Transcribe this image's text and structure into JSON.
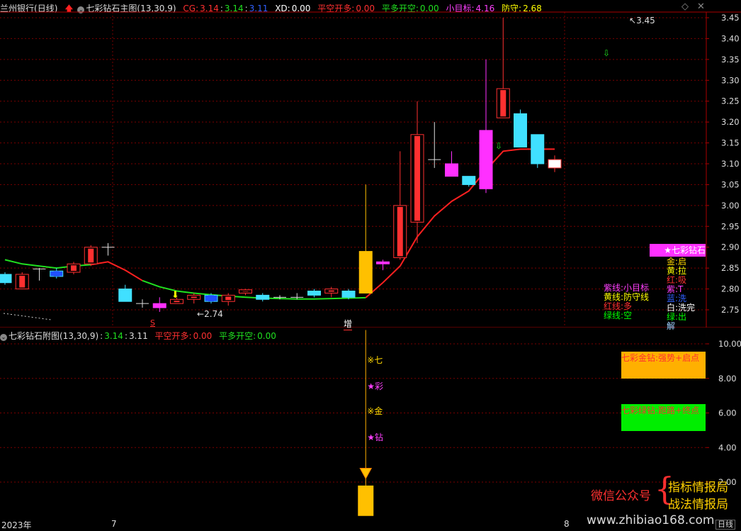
{
  "header": {
    "stock_name": "兰州银行",
    "period": "(日线)",
    "indicator_main": "七彩钻石主图(13,30,9)",
    "cg_label": "CG:",
    "cg_values": [
      "3.14",
      "3.14",
      "3.11"
    ],
    "xd_label": "XD:",
    "xd_value": "0.00",
    "pingkong_label": "平空开多:",
    "pingkong_value": "0.00",
    "pingduo_label": "平多开空:",
    "pingduo_value": "0.00",
    "target_label": "小目标:",
    "target_value": "4.16",
    "defense_label": "防守:",
    "defense_value": "2.68"
  },
  "sub_header": {
    "indicator": "七彩钻石附图(13,30,9)",
    "v1": "3.14",
    "v2": "3.11",
    "pingkong_label": "平空开多:",
    "pingkong_value": "0.00",
    "pingduo_label": "平多开空:",
    "pingduo_value": "0.00"
  },
  "main_axis": {
    "min": 2.7,
    "max": 3.475,
    "ticks": [
      "3.45",
      "3.40",
      "3.35",
      "3.30",
      "3.25",
      "3.20",
      "3.15",
      "3.10",
      "3.05",
      "3.00",
      "2.95",
      "2.90",
      "2.85",
      "2.80",
      "2.75"
    ]
  },
  "sub_axis": {
    "min": 0,
    "max": 11,
    "ticks": [
      "10.00",
      "8.00",
      "6.00",
      "4.00",
      "2.00"
    ]
  },
  "x_axis": {
    "labels": [
      "2023年",
      "7",
      "8"
    ],
    "period_button": "日线"
  },
  "annotations": {
    "high_price": "3.45",
    "low_price": "2.74",
    "s_marker": "S",
    "zeng_marker": "增"
  },
  "main_legend": {
    "title": "★七彩钻石",
    "right_items": [
      {
        "text": "金:启",
        "color": "#ffd700"
      },
      {
        "text": "黄:拉",
        "color": "#ffff00"
      },
      {
        "text": "红:吸",
        "color": "#ff3030"
      },
      {
        "text": "紫:T",
        "color": "#ff40ff"
      },
      {
        "text": "蓝:洗",
        "color": "#3060ff"
      },
      {
        "text": "白:洗完",
        "color": "#ffffff"
      },
      {
        "text": "绿:出",
        "color": "#00ff00"
      },
      {
        "text": "解",
        "color": "#a0d0ff"
      }
    ],
    "left_items": [
      {
        "text": "紫线:小目标",
        "color": "#ff40ff"
      },
      {
        "text": "黄线:防守线",
        "color": "#ffff00"
      },
      {
        "text": "红线:多",
        "color": "#ff3030"
      },
      {
        "text": "绿线:空",
        "color": "#00ff00"
      }
    ]
  },
  "sub_legend": [
    {
      "text": "七彩金钻:强势+启点",
      "bg": "#ffb000",
      "color": "#ff3030"
    },
    {
      "text": "七彩绿钻:跑路+终点",
      "bg": "#00ee00",
      "color": "#ff3030"
    }
  ],
  "sub_signals": [
    {
      "text": "※七",
      "color": "#ffd700"
    },
    {
      "text": "★彩",
      "color": "#ff40ff"
    },
    {
      "text": "※金",
      "color": "#ffd700"
    },
    {
      "text": "★钻",
      "color": "#ff40ff"
    }
  ],
  "watermark": {
    "prefix": "微信公众号",
    "line1": "指标情报局",
    "line2": "战法情报局",
    "url": "www.zhibiao168.com"
  },
  "colors": {
    "up": "#ff3030",
    "down_cyan": "#40e0ff",
    "down_blue": "#2050ff",
    "magenta": "#ff30ff",
    "gold": "#ffc000",
    "line_red": "#ff2020",
    "line_green": "#20e020",
    "grid": "#7a0000"
  },
  "chart_data": {
    "type": "candlestick",
    "candles": [
      {
        "o": 2.835,
        "c": 2.815,
        "h": 2.84,
        "l": 2.81,
        "t": "cyan"
      },
      {
        "o": 2.8,
        "c": 2.835,
        "h": 2.84,
        "l": 2.8,
        "t": "up"
      },
      {
        "o": 2.848,
        "c": 2.848,
        "h": 2.85,
        "l": 2.82,
        "t": "doji"
      },
      {
        "o": 2.843,
        "c": 2.83,
        "h": 2.85,
        "l": 2.825,
        "t": "blue"
      },
      {
        "o": 2.84,
        "c": 2.86,
        "h": 2.865,
        "l": 2.835,
        "t": "up"
      },
      {
        "o": 2.86,
        "c": 2.9,
        "h": 2.905,
        "l": 2.855,
        "t": "up"
      },
      {
        "o": 2.9,
        "c": 2.9,
        "h": 2.91,
        "l": 2.88,
        "t": "doji"
      },
      {
        "o": 2.8,
        "c": 2.77,
        "h": 2.81,
        "l": 2.77,
        "t": "cyan"
      },
      {
        "o": 2.765,
        "c": 2.765,
        "h": 2.775,
        "l": 2.755,
        "t": "doji"
      },
      {
        "o": 2.755,
        "c": 2.765,
        "h": 2.78,
        "l": 2.745,
        "t": "magenta"
      },
      {
        "o": 2.765,
        "c": 2.775,
        "h": 2.78,
        "l": 2.765,
        "t": "up"
      },
      {
        "o": 2.775,
        "c": 2.785,
        "h": 2.79,
        "l": 2.765,
        "t": "up"
      },
      {
        "o": 2.785,
        "c": 2.77,
        "h": 2.79,
        "l": 2.765,
        "t": "blue"
      },
      {
        "o": 2.77,
        "c": 2.785,
        "h": 2.79,
        "l": 2.76,
        "t": "up"
      },
      {
        "o": 2.79,
        "c": 2.798,
        "h": 2.8,
        "l": 2.785,
        "t": "up"
      },
      {
        "o": 2.785,
        "c": 2.775,
        "h": 2.79,
        "l": 2.77,
        "t": "cyan"
      },
      {
        "o": 2.78,
        "c": 2.78,
        "h": 2.785,
        "l": 2.775,
        "t": "doji"
      },
      {
        "o": 2.78,
        "c": 2.78,
        "h": 2.79,
        "l": 2.775,
        "t": "doji"
      },
      {
        "o": 2.795,
        "c": 2.785,
        "h": 2.8,
        "l": 2.78,
        "t": "cyan"
      },
      {
        "o": 2.79,
        "c": 2.8,
        "h": 2.805,
        "l": 2.78,
        "t": "up"
      },
      {
        "o": 2.795,
        "c": 2.78,
        "h": 2.8,
        "l": 2.775,
        "t": "cyan"
      },
      {
        "o": 2.79,
        "c": 2.89,
        "h": 3.05,
        "l": 2.79,
        "t": "gold"
      },
      {
        "o": 2.86,
        "c": 2.865,
        "h": 2.87,
        "l": 2.845,
        "t": "magenta"
      },
      {
        "o": 2.875,
        "c": 3.0,
        "h": 3.13,
        "l": 2.87,
        "t": "up"
      },
      {
        "o": 2.96,
        "c": 3.17,
        "h": 3.25,
        "l": 2.91,
        "t": "up"
      },
      {
        "o": 3.11,
        "c": 3.11,
        "h": 3.2,
        "l": 3.09,
        "t": "doji"
      },
      {
        "o": 3.07,
        "c": 3.1,
        "h": 3.13,
        "l": 3.07,
        "t": "magenta"
      },
      {
        "o": 3.07,
        "c": 3.05,
        "h": 3.07,
        "l": 3.045,
        "t": "cyan"
      },
      {
        "o": 3.04,
        "c": 3.18,
        "h": 3.35,
        "l": 3.03,
        "t": "magenta"
      },
      {
        "o": 3.21,
        "c": 3.28,
        "h": 3.45,
        "l": 3.21,
        "t": "up"
      },
      {
        "o": 3.22,
        "c": 3.14,
        "h": 3.23,
        "l": 3.14,
        "t": "cyan"
      },
      {
        "o": 3.17,
        "c": 3.1,
        "h": 3.17,
        "l": 3.09,
        "t": "cyan"
      },
      {
        "o": 3.09,
        "c": 3.11,
        "h": 3.12,
        "l": 3.08,
        "t": "white"
      }
    ],
    "trend_line": [
      2.87,
      2.86,
      2.855,
      2.85,
      2.855,
      2.858,
      2.865,
      2.845,
      2.82,
      2.805,
      2.795,
      2.79,
      2.786,
      2.783,
      2.78,
      2.778,
      2.777,
      2.776,
      2.776,
      2.777,
      2.778,
      2.779,
      2.815,
      2.855,
      2.925,
      2.975,
      3.01,
      3.035,
      3.085,
      3.13,
      3.135,
      3.135,
      3.135
    ],
    "trend_color_split": 7,
    "trend_green_end": 21,
    "sub_signal_bar": {
      "index": 21,
      "value": 1.8
    }
  }
}
